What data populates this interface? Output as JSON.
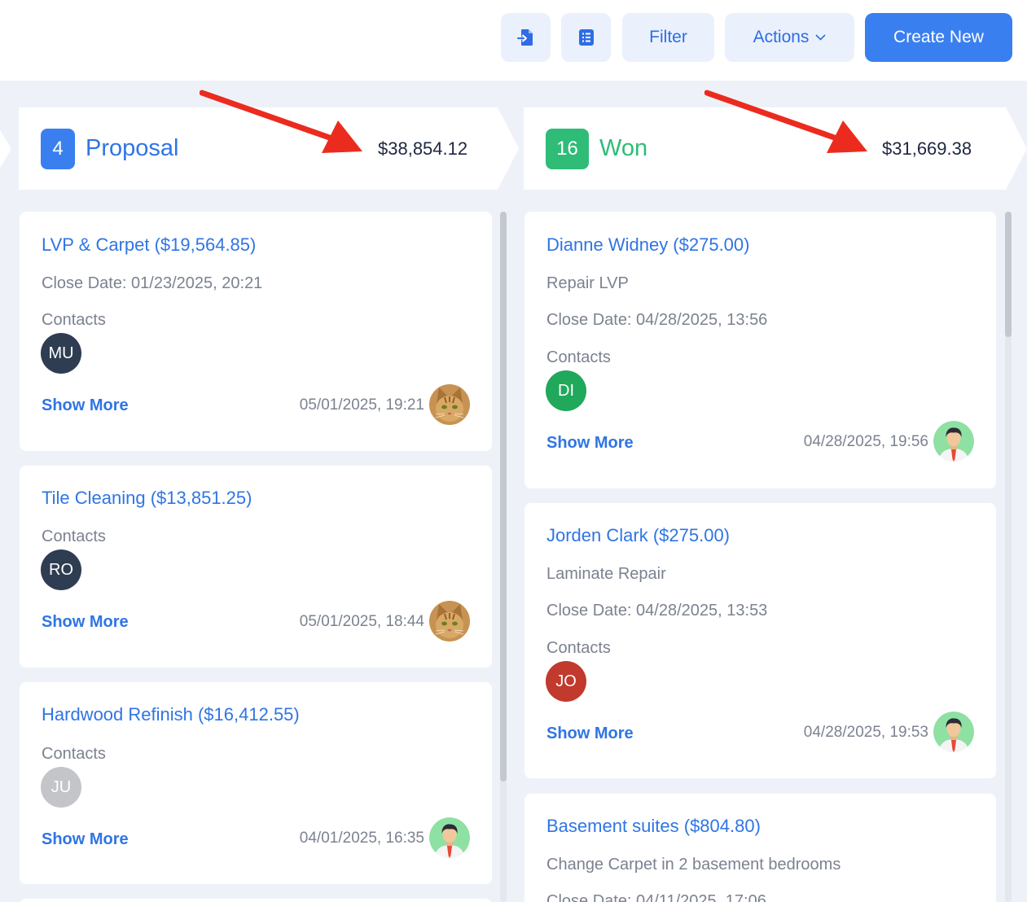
{
  "toolbar": {
    "import_icon": "import-file-icon",
    "list_icon": "list-view-icon",
    "filter_label": "Filter",
    "actions_label": "Actions",
    "create_label": "Create New"
  },
  "colors": {
    "proposal": "#3a7ff0",
    "won": "#2ebc77",
    "arrow": "#ec2b1f"
  },
  "columns": [
    {
      "count": "4",
      "name": "Proposal",
      "total": "$38,854.12",
      "cards": [
        {
          "title": "LVP & Carpet ($19,564.85)",
          "description": "",
          "close_date": "Close Date: 01/23/2025, 20:21",
          "contacts_label": "Contacts",
          "contact_initials": "MU",
          "contact_color": "#2f3d52",
          "show_more": "Show More",
          "timestamp": "05/01/2025, 19:21",
          "owner_avatar": "cat-avatar"
        },
        {
          "title": "Tile Cleaning ($13,851.25)",
          "description": "",
          "close_date": "",
          "contacts_label": "Contacts",
          "contact_initials": "RO",
          "contact_color": "#2f3d52",
          "show_more": "Show More",
          "timestamp": "05/01/2025, 18:44",
          "owner_avatar": "cat-avatar"
        },
        {
          "title": "Hardwood Refinish ($16,412.55)",
          "description": "",
          "close_date": "",
          "contacts_label": "Contacts",
          "contact_initials": "JU",
          "contact_color": "#c3c5c9",
          "show_more": "Show More",
          "timestamp": "04/01/2025, 16:35",
          "owner_avatar": "man-avatar"
        }
      ]
    },
    {
      "count": "16",
      "name": "Won",
      "total": "$31,669.38",
      "cards": [
        {
          "title": "Dianne Widney ($275.00)",
          "description": "Repair LVP",
          "close_date": "Close Date: 04/28/2025, 13:56",
          "contacts_label": "Contacts",
          "contact_initials": "DI",
          "contact_color": "#20a85b",
          "show_more": "Show More",
          "timestamp": "04/28/2025, 19:56",
          "owner_avatar": "man-avatar"
        },
        {
          "title": "Jorden Clark ($275.00)",
          "description": "Laminate Repair",
          "close_date": "Close Date: 04/28/2025, 13:53",
          "contacts_label": "Contacts",
          "contact_initials": "JO",
          "contact_color": "#c2392d",
          "show_more": "Show More",
          "timestamp": "04/28/2025, 19:53",
          "owner_avatar": "man-avatar"
        },
        {
          "title": "Basement suites ($804.80)",
          "description": "Change Carpet in 2 basement bedrooms",
          "close_date": "Close Date: 04/11/2025, 17:06",
          "contacts_label": "",
          "contact_initials": "",
          "contact_color": "#2f3d52",
          "show_more": "",
          "timestamp": "",
          "owner_avatar": ""
        }
      ]
    }
  ]
}
